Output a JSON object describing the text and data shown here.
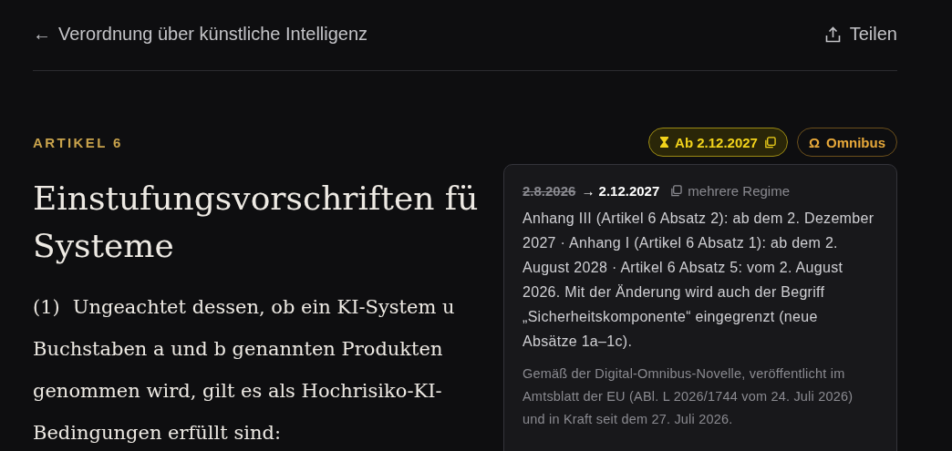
{
  "topbar": {
    "back_arrow": "←",
    "title": "Verordnung über künstliche Intelligenz",
    "share_label": "Teilen"
  },
  "article": {
    "label": "ARTIKEL 6",
    "badges": [
      {
        "kind": "date",
        "label": "Ab 2.12.2027"
      },
      {
        "kind": "omnibus",
        "symbol": "Ω",
        "label": "Omnibus"
      }
    ],
    "title_lines": [
      "Einstufungsvorschriften fü",
      "Systeme"
    ],
    "paragraph": {
      "number": "(1)",
      "lines": [
        "Ungeachtet dessen, ob ein KI-System u",
        "Buchstaben a und b genannten Produkten",
        "genommen wird, gilt es als Hochrisiko-KI-",
        "Bedingungen erfüllt sind:"
      ]
    }
  },
  "popover": {
    "old_date": "2.8.2026",
    "arrow": "→",
    "new_date": "2.12.2027",
    "note": "mehrere Regime",
    "body": "Anhang III (Artikel 6 Absatz 2): ab dem 2. Dezember 2027 · Anhang I (Artikel 6 Absatz 1): ab dem 2. August 2028 · Artikel 6 Absatz 5: vom 2. August 2026. Mit der Änderung wird auch der Begriff „Sicherheitskomponente“ eingegrenzt (neue Absätze 1a–1c).",
    "footer": "Gemäß der Digital-Omnibus-Novelle, veröffentlicht im Amtsblatt der EU (ABl. L 2026/1744 vom 24. Juli 2026) und in Kraft seit dem 27. Juli 2026."
  }
}
